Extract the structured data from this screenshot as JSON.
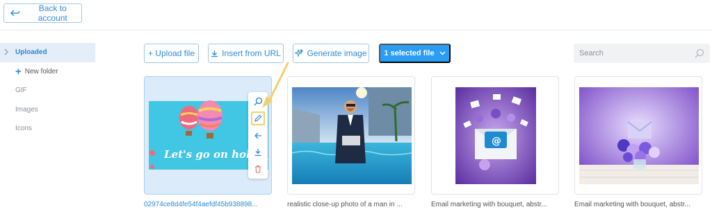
{
  "header": {
    "back_label": "Back to account"
  },
  "sidebar": {
    "items": [
      {
        "label": "Uploaded",
        "active": true
      },
      {
        "label": "New folder"
      },
      {
        "label": "GIF"
      },
      {
        "label": "Images"
      },
      {
        "label": "Icons"
      }
    ]
  },
  "toolbar": {
    "upload_label": "+ Upload file",
    "insert_url_label": "Insert from URL",
    "generate_label": "Generate image",
    "selected_label": "1 selected file"
  },
  "search": {
    "placeholder": "Search"
  },
  "gallery": {
    "items": [
      {
        "caption": "02974ce8d4fe54f4aefdf45b938898...",
        "image_text": "Let's go on holiday",
        "selected": true
      },
      {
        "caption": "realistic close-up photo of a man in ..."
      },
      {
        "caption": "Email marketing with bouquet, abstr..."
      },
      {
        "caption": "Email marketing with bouquet, abstr..."
      }
    ],
    "actions": [
      "search-icon",
      "pencil-icon",
      "share-icon",
      "download-icon",
      "trash-icon"
    ]
  },
  "colors": {
    "accent": "#2a9df4",
    "highlight": "#f3cf6b",
    "selected_bg": "#dcebf9"
  }
}
